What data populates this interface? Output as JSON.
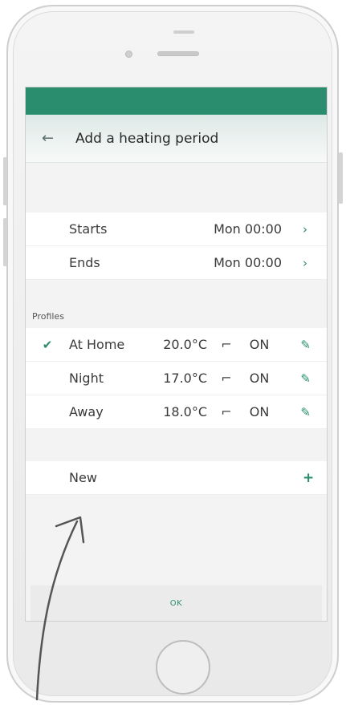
{
  "header": {
    "back_icon": "arrow-left-icon",
    "title": "Add a heating period"
  },
  "period": {
    "starts_label": "Starts",
    "starts_value": "Mon 00:00",
    "ends_label": "Ends",
    "ends_value": "Mon 00:00"
  },
  "profiles": {
    "section_label": "Profiles",
    "items": [
      {
        "name": "At Home",
        "temp": "20.0°C",
        "state": "ON",
        "selected": true
      },
      {
        "name": "Night",
        "temp": "17.0°C",
        "state": "ON",
        "selected": false
      },
      {
        "name": "Away",
        "temp": "18.0°C",
        "state": "ON",
        "selected": false
      }
    ],
    "new_label": "New"
  },
  "footer": {
    "ok_label": "OK"
  },
  "colors": {
    "accent": "#2a8d6e",
    "background": "#f3f3f3"
  }
}
